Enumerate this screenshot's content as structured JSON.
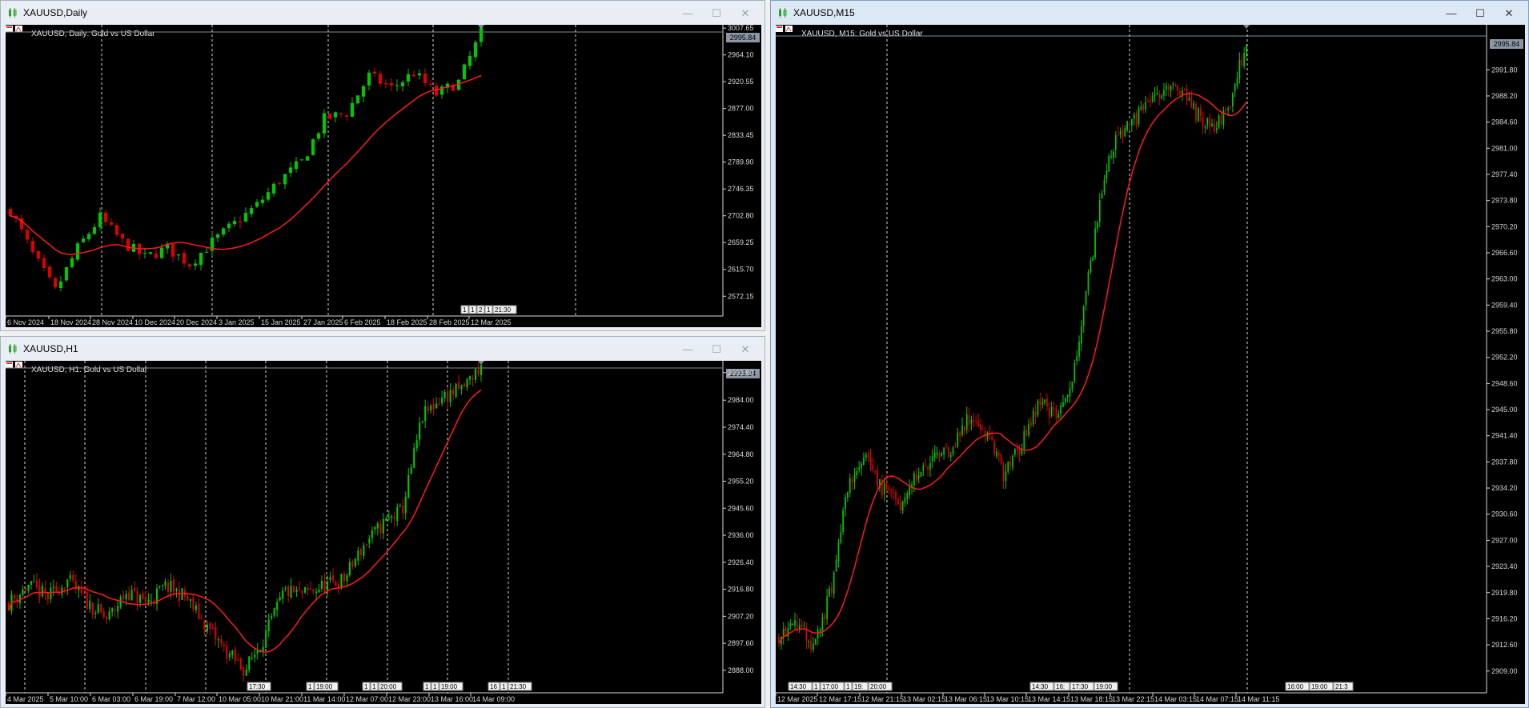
{
  "windows": {
    "daily": {
      "title": "XAUUSD,Daily",
      "label": "XAUUSD, Daily:  Gold vs US Dollar",
      "price_box": "2995.84",
      "price_axis": [
        "3007.65",
        "2964.10",
        "2920.55",
        "2877.00",
        "2833.45",
        "2789.90",
        "2746.35",
        "2702.80",
        "2659.25",
        "2615.70",
        "2572.15"
      ],
      "time_axis": [
        "6 Nov 2024",
        "18 Nov 2024",
        "28 Nov 2024",
        "10 Dec 2024",
        "20 Dec 2024",
        "3 Jan 2025",
        "15 Jan 2025",
        "27 Jan 2025",
        "6 Feb 2025",
        "18 Feb 2025",
        "28 Feb 2025",
        "12 Mar 2025"
      ],
      "session_marks": [
        "1",
        "1",
        "2",
        "1",
        "21:30"
      ]
    },
    "h1": {
      "title": "XAUUSD,H1",
      "label": "XAUUSD, H1:  Gold vs US Dollar",
      "price_box": "2995.84",
      "price_axis": [
        "2993.80",
        "2984.00",
        "2974.40",
        "2964.80",
        "2955.20",
        "2945.60",
        "2936.00",
        "2926.40",
        "2916.80",
        "2907.20",
        "2897.60",
        "2888.00"
      ],
      "time_axis": [
        "4 Mar 2025",
        "5 Mar 10:00",
        "6 Mar 03:00",
        "6 Mar 19:00",
        "7 Mar 12:00",
        "10 Mar 05:00",
        "10 Mar 21:00",
        "11 Mar 14:00",
        "12 Mar 07:00",
        "12 Mar 23:00",
        "13 Mar 16:00",
        "14 Mar 09:00"
      ],
      "session_marks_a": [
        "17:30"
      ],
      "session_marks_b": [
        "1",
        "19:00"
      ],
      "session_marks_c": [
        "1",
        "1",
        "20:00"
      ],
      "session_marks_d": [
        "1",
        "1",
        "19:00"
      ],
      "session_marks_e": [
        "16",
        "1",
        "21:30"
      ]
    },
    "m15": {
      "title": "XAUUSD,M15",
      "label": "XAUUSD, M15:  Gold vs US Dollar",
      "price_box": "2995.84",
      "price_axis": [
        "2991.80",
        "2988.20",
        "2984.60",
        "2981.00",
        "2977.40",
        "2973.80",
        "2970.20",
        "2966.60",
        "2963.00",
        "2959.40",
        "2955.80",
        "2952.20",
        "2948.60",
        "2945.00",
        "2941.40",
        "2937.80",
        "2934.20",
        "2930.60",
        "2927.00",
        "2923.40",
        "2919.80",
        "2916.20",
        "2912.60",
        "2909.00"
      ],
      "time_axis": [
        "12 Mar 2025",
        "12 Mar 17:15",
        "12 Mar 21:15",
        "13 Mar 02:15",
        "13 Mar 06:15",
        "13 Mar 10:15",
        "13 Mar 14:15",
        "13 Mar 18:15",
        "13 Mar 22:15",
        "14 Mar 03:15",
        "14 Mar 07:15",
        "14 Mar 11:15"
      ],
      "session_marks_a": [
        "14:30",
        "1",
        "17:00",
        "1",
        "19:",
        "20:00"
      ],
      "session_marks_b": [
        "14:30",
        "16:",
        "17:30",
        "19:00"
      ],
      "session_marks_c": [
        "16:00",
        "19:00",
        "21:3"
      ]
    }
  },
  "colors": {
    "bull": "#00c800",
    "bear": "#e00000",
    "ma": "#ff1a1a",
    "grid": "#d8d8d8",
    "axis_text": "#d8d8d8"
  }
}
